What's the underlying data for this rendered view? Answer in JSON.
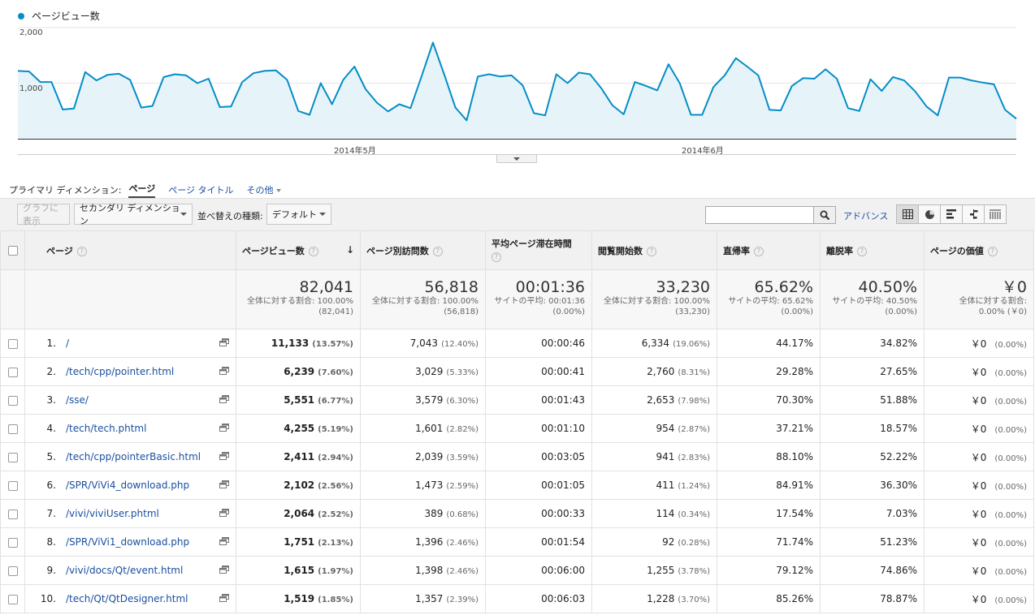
{
  "chart": {
    "legend": "ページビュー数",
    "color": "#058dc7",
    "y_ticks": [
      "2,000",
      "1,000"
    ],
    "x_ticks": [
      "2014年5月",
      "2014年6月"
    ]
  },
  "chart_data": {
    "type": "area",
    "ylim": [
      0,
      2000
    ],
    "series": [
      {
        "name": "ページビュー数",
        "values": [
          1220,
          1210,
          1020,
          1020,
          525,
          545,
          1200,
          1050,
          1150,
          1170,
          1060,
          560,
          590,
          1110,
          1160,
          1140,
          1000,
          1080,
          570,
          580,
          1020,
          1180,
          1220,
          1230,
          1060,
          500,
          430,
          1000,
          620,
          1060,
          1300,
          890,
          650,
          490,
          620,
          550,
          1130,
          1730,
          1160,
          560,
          330,
          1120,
          1160,
          1120,
          1140,
          960,
          460,
          420,
          1160,
          1000,
          1190,
          1160,
          910,
          600,
          440,
          1020,
          950,
          870,
          1340,
          1000,
          430,
          430,
          930,
          1140,
          1450,
          1300,
          1140,
          520,
          510,
          950,
          1090,
          1080,
          1250,
          1080,
          550,
          500,
          1070,
          860,
          1110,
          1050,
          850,
          580,
          420,
          1100,
          1100,
          1050,
          1010,
          980,
          520,
          360
        ]
      }
    ]
  },
  "primary_dim": {
    "label": "プライマリ ディメンション:",
    "active": "ページ",
    "option2": "ページ タイトル",
    "other": "その他"
  },
  "toolbar": {
    "graph_btn": "グラフに表示",
    "secondary_dim": "セカンダリ ディメンション",
    "sort_label": "並べ替えの種類:",
    "sort_value": "デフォルト",
    "advanced": "アドバンス"
  },
  "columns": {
    "page": "ページ",
    "pageviews": "ページビュー数",
    "unique": "ページ別訪問数",
    "avgtime": "平均ページ滞在時間",
    "entrances": "閲覧開始数",
    "bounce": "直帰率",
    "exit": "離脱率",
    "value": "ページの価値"
  },
  "totals": {
    "pageviews": {
      "big": "82,041",
      "sub1": "全体に対する割合: 100.00%",
      "sub2": "(82,041)"
    },
    "unique": {
      "big": "56,818",
      "sub1": "全体に対する割合: 100.00%",
      "sub2": "(56,818)"
    },
    "avgtime": {
      "big": "00:01:36",
      "sub1": "サイトの平均: 00:01:36",
      "sub2": "(0.00%)"
    },
    "entrances": {
      "big": "33,230",
      "sub1": "全体に対する割合: 100.00%",
      "sub2": "(33,230)"
    },
    "bounce": {
      "big": "65.62%",
      "sub1": "サイトの平均: 65.62%",
      "sub2": "(0.00%)"
    },
    "exit": {
      "big": "40.50%",
      "sub1": "サイトの平均: 40.50%",
      "sub2": "(0.00%)"
    },
    "value": {
      "big": "￥0",
      "sub1": "全体に対する割合:",
      "sub2": "0.00% (￥0)"
    }
  },
  "rows": [
    {
      "rank": "1.",
      "page": "/",
      "pv": "11,133",
      "pvp": "(13.57%)",
      "u": "7,043",
      "up": "(12.40%)",
      "t": "00:00:46",
      "e": "6,334",
      "ep": "(19.06%)",
      "b": "44.17%",
      "x": "34.82%",
      "v": "￥0",
      "vp": "(0.00%)"
    },
    {
      "rank": "2.",
      "page": "/tech/cpp/pointer.html",
      "pv": "6,239",
      "pvp": "(7.60%)",
      "u": "3,029",
      "up": "(5.33%)",
      "t": "00:00:41",
      "e": "2,760",
      "ep": "(8.31%)",
      "b": "29.28%",
      "x": "27.65%",
      "v": "￥0",
      "vp": "(0.00%)"
    },
    {
      "rank": "3.",
      "page": "/sse/",
      "pv": "5,551",
      "pvp": "(6.77%)",
      "u": "3,579",
      "up": "(6.30%)",
      "t": "00:01:43",
      "e": "2,653",
      "ep": "(7.98%)",
      "b": "70.30%",
      "x": "51.88%",
      "v": "￥0",
      "vp": "(0.00%)"
    },
    {
      "rank": "4.",
      "page": "/tech/tech.phtml",
      "pv": "4,255",
      "pvp": "(5.19%)",
      "u": "1,601",
      "up": "(2.82%)",
      "t": "00:01:10",
      "e": "954",
      "ep": "(2.87%)",
      "b": "37.21%",
      "x": "18.57%",
      "v": "￥0",
      "vp": "(0.00%)"
    },
    {
      "rank": "5.",
      "page": "/tech/cpp/pointerBasic.html",
      "pv": "2,411",
      "pvp": "(2.94%)",
      "u": "2,039",
      "up": "(3.59%)",
      "t": "00:03:05",
      "e": "941",
      "ep": "(2.83%)",
      "b": "88.10%",
      "x": "52.22%",
      "v": "￥0",
      "vp": "(0.00%)"
    },
    {
      "rank": "6.",
      "page": "/SPR/ViVi4_download.php",
      "pv": "2,102",
      "pvp": "(2.56%)",
      "u": "1,473",
      "up": "(2.59%)",
      "t": "00:01:05",
      "e": "411",
      "ep": "(1.24%)",
      "b": "84.91%",
      "x": "36.30%",
      "v": "￥0",
      "vp": "(0.00%)"
    },
    {
      "rank": "7.",
      "page": "/vivi/viviUser.phtml",
      "pv": "2,064",
      "pvp": "(2.52%)",
      "u": "389",
      "up": "(0.68%)",
      "t": "00:00:33",
      "e": "114",
      "ep": "(0.34%)",
      "b": "17.54%",
      "x": "7.03%",
      "v": "￥0",
      "vp": "(0.00%)"
    },
    {
      "rank": "8.",
      "page": "/SPR/ViVi1_download.php",
      "pv": "1,751",
      "pvp": "(2.13%)",
      "u": "1,396",
      "up": "(2.46%)",
      "t": "00:01:54",
      "e": "92",
      "ep": "(0.28%)",
      "b": "71.74%",
      "x": "51.23%",
      "v": "￥0",
      "vp": "(0.00%)"
    },
    {
      "rank": "9.",
      "page": "/vivi/docs/Qt/event.html",
      "pv": "1,615",
      "pvp": "(1.97%)",
      "u": "1,398",
      "up": "(2.46%)",
      "t": "00:06:00",
      "e": "1,255",
      "ep": "(3.78%)",
      "b": "79.12%",
      "x": "74.86%",
      "v": "￥0",
      "vp": "(0.00%)"
    },
    {
      "rank": "10.",
      "page": "/tech/Qt/QtDesigner.html",
      "pv": "1,519",
      "pvp": "(1.85%)",
      "u": "1,357",
      "up": "(2.39%)",
      "t": "00:06:03",
      "e": "1,228",
      "ep": "(3.70%)",
      "b": "85.26%",
      "x": "78.87%",
      "v": "￥0",
      "vp": "(0.00%)"
    }
  ]
}
